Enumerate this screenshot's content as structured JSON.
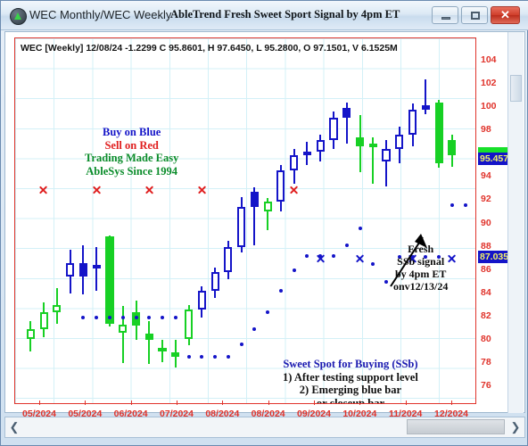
{
  "window": {
    "app_label": "WEC Monthly/WEC Weekly",
    "doc_title": "AbleTrend Fresh Sweet Sport Signal by 4pm ET",
    "minimize_label": "",
    "maximize_label": "",
    "close_label": "✕"
  },
  "chart_header": {
    "info_line": "WEC [Weekly] 12/08/24  -1.2299 C 95.8601, H 97.6450, L 95.2800, O 97.1501, V 6.1525M",
    "symbol": "WEC",
    "interval": "[Weekly]",
    "date": "12/08/24",
    "change": "-1.2299",
    "close": "95.8601",
    "high": "97.6450",
    "low": "95.2800",
    "open": "97.1501",
    "volume": "6.1525M"
  },
  "annotations": {
    "slogan": {
      "line1": "Buy on Blue",
      "line2": "Sell on Red",
      "line3": "Trading Made Easy",
      "line4": "AbleSys Since 1994",
      "color1": "#1414c8",
      "color2": "#e02020",
      "color3": "#0a8c2a"
    },
    "sweet_spot": {
      "title": "Sweet Spot for Buying (SSb)",
      "item1": "1) After testing support level",
      "item2": "2) Emerging blue bar",
      "item3": "or closeup bar"
    },
    "fresh_signal": {
      "line1": "Fresh",
      "line2": "SSb signal",
      "line3": "by 4pm ET",
      "line4": "onv12/13/24"
    }
  },
  "price_markers": [
    {
      "value": "95.4570",
      "kind": "current-price",
      "bg": "#1414c8",
      "fg": "#f2f268",
      "cap": "#17e02a"
    },
    {
      "value": "87.0354",
      "kind": "stop-level",
      "bg": "#1414c8",
      "fg": "#f2f268",
      "cap": ""
    }
  ],
  "chart_data": {
    "type": "candlestick",
    "title": "AbleTrend Fresh Sweet Sport Signal by 4pm ET",
    "subtitle": "WEC [Weekly] 12/08/24  -1.2299 C 95.8601, H 97.6450, L 95.2800, O 97.1501, V 6.1525M",
    "xlabel": "",
    "ylabel": "",
    "ylim": [
      75,
      105
    ],
    "grid": true,
    "legend": "none",
    "y_ticks": [
      104,
      102,
      100,
      98,
      96,
      94,
      92,
      90,
      88,
      86,
      84,
      82,
      80,
      78,
      76
    ],
    "y_tick_labels": [
      "104",
      "102",
      "100",
      "98",
      "",
      "94",
      "92",
      "90",
      "88",
      "86",
      "84",
      "82",
      "80",
      "78",
      "76"
    ],
    "x_tick_labels": [
      "05/2024",
      "05/2024",
      "06/2024",
      "07/2024",
      "08/2024",
      "08/2024",
      "09/2024",
      "10/2024",
      "11/2024",
      "12/2024"
    ],
    "colors": {
      "up_blue": "#1414c8",
      "up_green": "#17d024",
      "axis_red": "#e0332b",
      "grid": "#d3f0f7",
      "dot_blue": "#1414c8",
      "x_red": "#e02020"
    },
    "bars": [
      {
        "i": 0,
        "o": 80.1,
        "h": 81.6,
        "l": 79.0,
        "c": 80.9,
        "color": "green",
        "fill": "hollow"
      },
      {
        "i": 1,
        "o": 80.9,
        "h": 83.2,
        "l": 80.2,
        "c": 82.4,
        "color": "green",
        "fill": "hollow"
      },
      {
        "i": 2,
        "o": 82.4,
        "h": 84.4,
        "l": 81.4,
        "c": 83.0,
        "color": "green",
        "fill": "hollow"
      },
      {
        "i": 3,
        "o": 85.4,
        "h": 87.7,
        "l": 84.0,
        "c": 86.6,
        "color": "blue",
        "fill": "hollow"
      },
      {
        "i": 4,
        "o": 86.6,
        "h": 88.1,
        "l": 83.9,
        "c": 85.4,
        "color": "blue",
        "fill": "solid"
      },
      {
        "i": 5,
        "o": 86.1,
        "h": 88.0,
        "l": 84.2,
        "c": 86.4,
        "color": "blue",
        "fill": "hollow"
      },
      {
        "i": 6,
        "o": 88.9,
        "h": 89.0,
        "l": 81.1,
        "c": 81.4,
        "color": "green",
        "fill": "solid"
      },
      {
        "i": 7,
        "o": 81.3,
        "h": 82.9,
        "l": 78.0,
        "c": 80.6,
        "color": "green",
        "fill": "hollow"
      },
      {
        "i": 8,
        "o": 81.2,
        "h": 83.4,
        "l": 80.0,
        "c": 82.4,
        "color": "green",
        "fill": "solid"
      },
      {
        "i": 9,
        "o": 80.0,
        "h": 81.6,
        "l": 77.9,
        "c": 80.5,
        "color": "green",
        "fill": "solid"
      },
      {
        "i": 10,
        "o": 79.0,
        "h": 80.0,
        "l": 78.1,
        "c": 79.3,
        "color": "green",
        "fill": "solid"
      },
      {
        "i": 11,
        "o": 78.5,
        "h": 80.0,
        "l": 77.6,
        "c": 78.9,
        "color": "green",
        "fill": "solid"
      },
      {
        "i": 12,
        "o": 80.1,
        "h": 83.0,
        "l": 79.5,
        "c": 82.6,
        "color": "green",
        "fill": "hollow"
      },
      {
        "i": 13,
        "o": 82.6,
        "h": 84.6,
        "l": 81.9,
        "c": 84.2,
        "color": "blue",
        "fill": "hollow"
      },
      {
        "i": 14,
        "o": 84.2,
        "h": 86.2,
        "l": 83.6,
        "c": 85.8,
        "color": "blue",
        "fill": "hollow"
      },
      {
        "i": 15,
        "o": 85.8,
        "h": 88.5,
        "l": 85.2,
        "c": 88.0,
        "color": "blue",
        "fill": "hollow"
      },
      {
        "i": 16,
        "o": 88.0,
        "h": 92.3,
        "l": 87.5,
        "c": 91.4,
        "color": "blue",
        "fill": "hollow"
      },
      {
        "i": 17,
        "o": 91.4,
        "h": 93.1,
        "l": 88.1,
        "c": 92.7,
        "color": "blue",
        "fill": "solid"
      },
      {
        "i": 18,
        "o": 91.0,
        "h": 92.2,
        "l": 89.4,
        "c": 91.9,
        "color": "green",
        "fill": "hollow"
      },
      {
        "i": 19,
        "o": 91.9,
        "h": 95.0,
        "l": 91.0,
        "c": 94.6,
        "color": "blue",
        "fill": "hollow"
      },
      {
        "i": 20,
        "o": 94.6,
        "h": 96.4,
        "l": 93.4,
        "c": 95.9,
        "color": "blue",
        "fill": "hollow"
      },
      {
        "i": 21,
        "o": 95.9,
        "h": 97.0,
        "l": 95.0,
        "c": 96.2,
        "color": "blue",
        "fill": "solid"
      },
      {
        "i": 22,
        "o": 96.2,
        "h": 97.6,
        "l": 95.3,
        "c": 97.2,
        "color": "blue",
        "fill": "hollow"
      },
      {
        "i": 23,
        "o": 97.2,
        "h": 99.6,
        "l": 96.4,
        "c": 99.1,
        "color": "blue",
        "fill": "hollow"
      },
      {
        "i": 24,
        "o": 99.1,
        "h": 100.4,
        "l": 96.9,
        "c": 99.9,
        "color": "blue",
        "fill": "solid"
      },
      {
        "i": 25,
        "o": 97.4,
        "h": 99.3,
        "l": 94.4,
        "c": 96.6,
        "color": "green",
        "fill": "solid"
      },
      {
        "i": 26,
        "o": 96.9,
        "h": 97.4,
        "l": 93.4,
        "c": 96.9,
        "color": "green",
        "fill": "hollow"
      },
      {
        "i": 27,
        "o": 95.3,
        "h": 97.2,
        "l": 93.2,
        "c": 96.4,
        "color": "blue",
        "fill": "hollow"
      },
      {
        "i": 28,
        "o": 96.4,
        "h": 98.3,
        "l": 95.2,
        "c": 97.6,
        "color": "blue",
        "fill": "hollow"
      },
      {
        "i": 29,
        "o": 97.6,
        "h": 100.3,
        "l": 96.6,
        "c": 99.8,
        "color": "blue",
        "fill": "hollow"
      },
      {
        "i": 30,
        "o": 99.8,
        "h": 102.4,
        "l": 99.4,
        "c": 100.2,
        "color": "blue",
        "fill": "solid"
      },
      {
        "i": 31,
        "o": 100.4,
        "h": 100.6,
        "l": 94.8,
        "c": 95.2,
        "color": "green",
        "fill": "solid"
      },
      {
        "i": 32,
        "o": 97.2,
        "h": 97.6,
        "l": 94.9,
        "c": 95.9,
        "color": "green",
        "fill": "solid"
      }
    ],
    "support_dots": [
      {
        "i": 4,
        "v": 81.9
      },
      {
        "i": 5,
        "v": 81.9
      },
      {
        "i": 6,
        "v": 81.9
      },
      {
        "i": 7,
        "v": 81.9
      },
      {
        "i": 8,
        "v": 81.9
      },
      {
        "i": 9,
        "v": 81.9
      },
      {
        "i": 10,
        "v": 81.9
      },
      {
        "i": 11,
        "v": 81.9
      },
      {
        "i": 12,
        "v": 78.5
      },
      {
        "i": 13,
        "v": 78.5
      },
      {
        "i": 14,
        "v": 78.5
      },
      {
        "i": 15,
        "v": 78.5
      },
      {
        "i": 16,
        "v": 79.6
      },
      {
        "i": 17,
        "v": 80.9
      },
      {
        "i": 18,
        "v": 82.4
      },
      {
        "i": 19,
        "v": 84.2
      },
      {
        "i": 20,
        "v": 86.0
      },
      {
        "i": 21,
        "v": 87.2
      },
      {
        "i": 22,
        "v": 87.2
      },
      {
        "i": 23,
        "v": 87.2
      },
      {
        "i": 24,
        "v": 88.1
      },
      {
        "i": 25,
        "v": 89.6
      },
      {
        "i": 26,
        "v": 86.5
      },
      {
        "i": 27,
        "v": 85.0
      },
      {
        "i": 28,
        "v": 87.1
      },
      {
        "i": 29,
        "v": 87.1
      },
      {
        "i": 30,
        "v": 87.1
      },
      {
        "i": 31,
        "v": 87.1
      },
      {
        "i": 32,
        "v": 91.6
      },
      {
        "i": 33,
        "v": 91.6
      }
    ],
    "sell_marks_red": [
      {
        "i": 1,
        "v": 92.9
      },
      {
        "i": 5,
        "v": 92.9
      },
      {
        "i": 9,
        "v": 92.9
      },
      {
        "i": 13,
        "v": 92.9
      },
      {
        "i": 20,
        "v": 92.9
      }
    ],
    "buy_marks_blue": [
      {
        "i": 22,
        "v": 87.0
      },
      {
        "i": 25,
        "v": 87.0
      },
      {
        "i": 29,
        "v": 87.0
      },
      {
        "i": 32,
        "v": 87.0
      }
    ]
  }
}
